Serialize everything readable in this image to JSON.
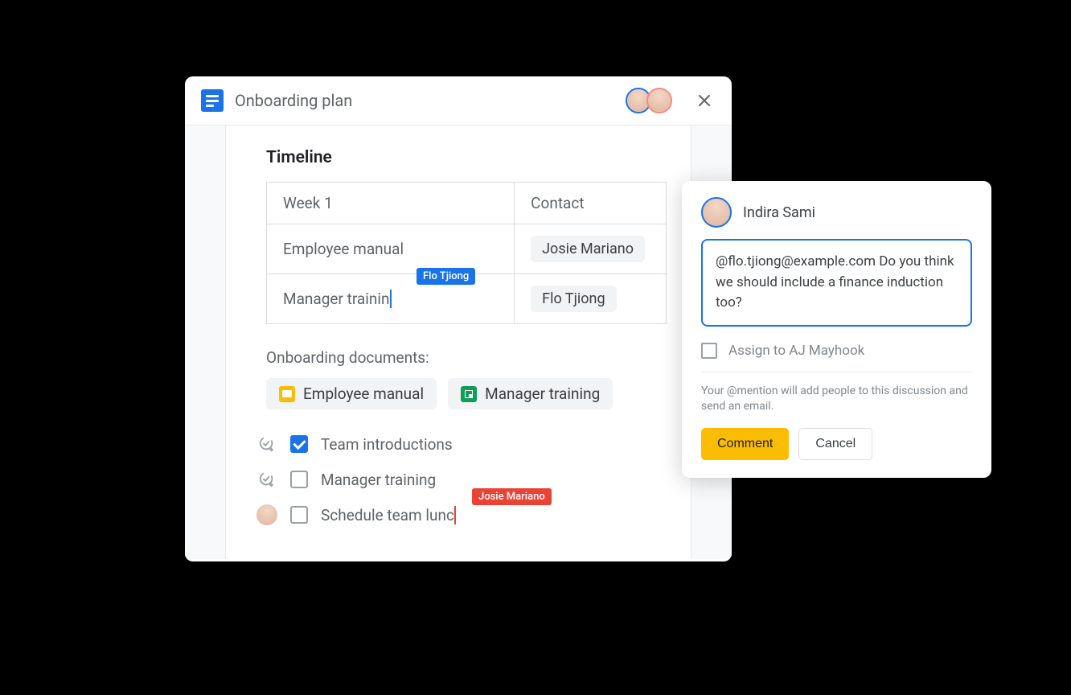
{
  "doc": {
    "title": "Onboarding plan",
    "collaborators": [
      "Indira Sami",
      "Josie Mariano"
    ]
  },
  "section_heading": "Timeline",
  "table": {
    "headers": [
      "Week 1",
      "Contact"
    ],
    "rows": [
      {
        "task": "Employee manual",
        "contact": "Josie Mariano"
      },
      {
        "task": "Manager trainin",
        "contact": "Flo Tjiong",
        "cursor_label": "Flo Tjiong"
      }
    ]
  },
  "documents_heading": "Onboarding documents:",
  "document_chips": [
    {
      "type": "slides",
      "label": "Employee manual"
    },
    {
      "type": "sheets",
      "label": "Manager training"
    }
  ],
  "checklist": [
    {
      "gutter": "assign-icon",
      "checked": true,
      "label": "Team introductions"
    },
    {
      "gutter": "assign-icon",
      "checked": false,
      "label": "Manager training"
    },
    {
      "gutter": "avatar",
      "checked": false,
      "label": "Schedule team lunc",
      "cursor_label": "Josie Mariano"
    }
  ],
  "comment": {
    "author": "Indira Sami",
    "text": "@flo.tjiong@example.com Do you think we should include a finance induction too?",
    "assign_label": "Assign to AJ Mayhook",
    "helper": "Your @mention will add people to this discussion and send an email.",
    "actions": {
      "primary": "Comment",
      "secondary": "Cancel"
    }
  }
}
